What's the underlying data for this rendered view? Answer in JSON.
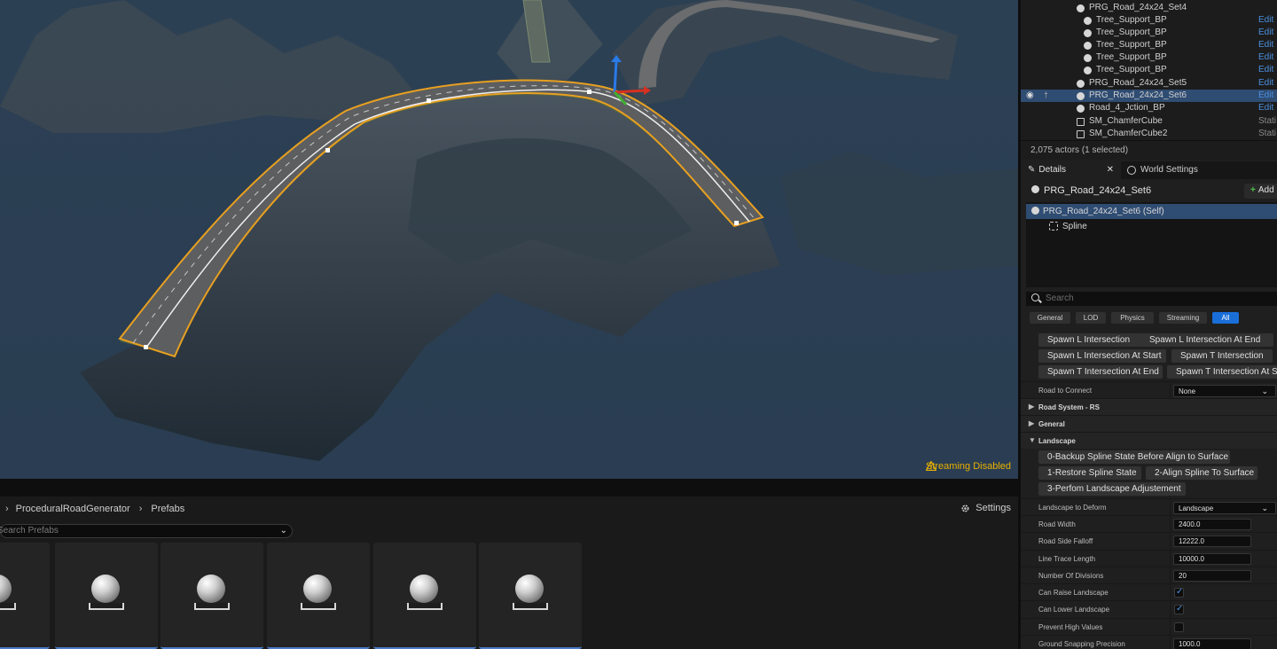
{
  "viewport": {
    "streaming_status": "Streaming Disabled"
  },
  "content_browser": {
    "breadcrumb": [
      "ProceduralRoadGenerator",
      "Prefabs"
    ],
    "settings_label": "Settings",
    "search_placeholder": "Search Prefabs",
    "tile_count": 6
  },
  "outliner": {
    "rows": [
      {
        "name": "PRG_Road_24x24_Set4",
        "action": "Edit",
        "indent": 1
      },
      {
        "name": "Tree_Support_BP",
        "action": "Edit",
        "indent": 2
      },
      {
        "name": "Tree_Support_BP",
        "action": "Edit",
        "indent": 2
      },
      {
        "name": "Tree_Support_BP",
        "action": "Edit",
        "indent": 2
      },
      {
        "name": "Tree_Support_BP",
        "action": "Edit",
        "indent": 2
      },
      {
        "name": "Tree_Support_BP",
        "action": "Edit",
        "indent": 2
      },
      {
        "name": "PRG_Road_24x24_Set5",
        "action": "Edit",
        "indent": 1
      },
      {
        "name": "PRG_Road_24x24_Set6",
        "action": "Edit",
        "indent": 1,
        "selected": true
      },
      {
        "name": "Road_4_Jction_BP",
        "action": "Edit",
        "indent": 1
      },
      {
        "name": "SM_ChamferCube",
        "action": "Stati",
        "indent": 1
      },
      {
        "name": "SM_ChamferCube2",
        "action": "Stati",
        "indent": 1
      }
    ],
    "footer": "2,075 actors (1 selected)"
  },
  "details": {
    "tab_details": "Details",
    "tab_world_settings": "World Settings",
    "actor_name": "PRG_Road_24x24_Set6",
    "add_label": "Add",
    "components": [
      {
        "label": "PRG_Road_24x24_Set6 (Self)",
        "selected": true
      },
      {
        "label": "Spline",
        "selected": false
      }
    ],
    "search_placeholder": "Search",
    "filters": [
      "General",
      "LOD",
      "Physics",
      "Streaming",
      "All"
    ],
    "active_filter": "All",
    "intersection_buttons": [
      [
        "Spawn L Intersection",
        "Spawn L Intersection At End"
      ],
      [
        "Spawn L Intersection At Start",
        "Spawn T Intersection"
      ],
      [
        "Spawn T Intersection At End",
        "Spawn T Intersection At Sta"
      ]
    ],
    "road_to_connect_label": "Road to Connect",
    "road_to_connect_value": "None",
    "categories": {
      "road_system": "Road System - RS",
      "general": "General",
      "landscape": "Landscape"
    },
    "landscape_buttons": [
      [
        "0-Backup Spline State Before Align to Surface"
      ],
      [
        "1-Restore Spline State",
        "2-Align Spline To Surface"
      ],
      [
        "3-Perfom Landscape Adjustement"
      ]
    ],
    "landscape_props": {
      "landscape_to_deform_label": "Landscape to Deform",
      "landscape_to_deform_value": "Landscape",
      "road_width_label": "Road Width",
      "road_width_value": "2400.0",
      "road_side_falloff_label": "Road Side Falloff",
      "road_side_falloff_value": "12222.0",
      "line_trace_length_label": "Line Trace Length",
      "line_trace_length_value": "10000.0",
      "num_divisions_label": "Number Of Divisions",
      "num_divisions_value": "20",
      "can_raise_label": "Can Raise Landscape",
      "can_raise_value": true,
      "can_lower_label": "Can Lower Landscape",
      "can_lower_value": true,
      "prevent_high_label": "Prevent High Values",
      "prevent_high_value": false,
      "ground_snap_label": "Ground Snapping Precision",
      "ground_snap_value": "1000.0"
    }
  },
  "colors": {
    "selection": "#2f4c72",
    "accent": "#1a6ed8",
    "warning": "#e8b000",
    "spline_outline": "#e8a020"
  }
}
